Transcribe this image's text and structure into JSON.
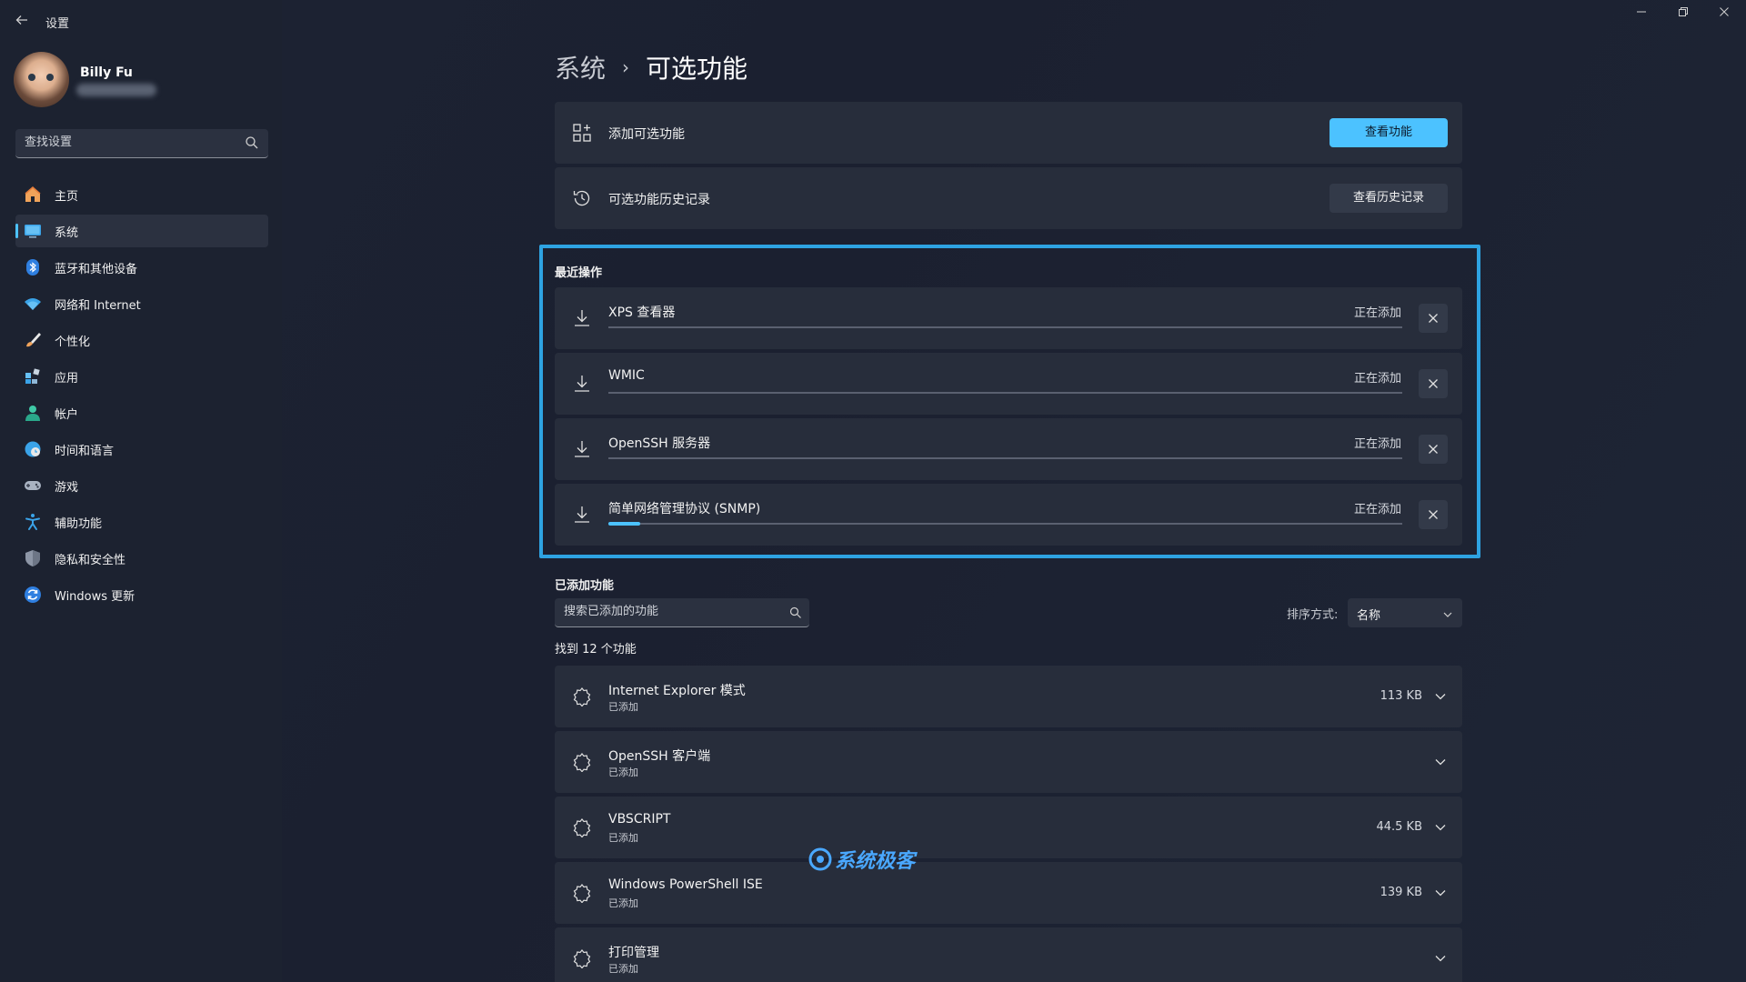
{
  "window": {
    "title": "设置",
    "back": "back-arrow",
    "controls": [
      "minimize",
      "maximize",
      "close"
    ]
  },
  "user": {
    "name": "Billy Fu"
  },
  "search": {
    "placeholder": "查找设置"
  },
  "sidebar": {
    "items": [
      {
        "label": "主页",
        "icon": "home-icon",
        "active": false
      },
      {
        "label": "系统",
        "icon": "system-icon",
        "active": true
      },
      {
        "label": "蓝牙和其他设备",
        "icon": "bluetooth-icon",
        "active": false
      },
      {
        "label": "网络和 Internet",
        "icon": "wifi-icon",
        "active": false
      },
      {
        "label": "个性化",
        "icon": "brush-icon",
        "active": false
      },
      {
        "label": "应用",
        "icon": "apps-icon",
        "active": false
      },
      {
        "label": "帐户",
        "icon": "account-icon",
        "active": false
      },
      {
        "label": "时间和语言",
        "icon": "globe-icon",
        "active": false
      },
      {
        "label": "游戏",
        "icon": "gamepad-icon",
        "active": false
      },
      {
        "label": "辅助功能",
        "icon": "accessibility-icon",
        "active": false
      },
      {
        "label": "隐私和安全性",
        "icon": "shield-icon",
        "active": false
      },
      {
        "label": "Windows 更新",
        "icon": "update-icon",
        "active": false
      }
    ]
  },
  "breadcrumb": {
    "parent": "系统",
    "separator": "›",
    "current": "可选功能"
  },
  "add_feature": {
    "label": "添加可选功能",
    "button": "查看功能"
  },
  "history": {
    "label": "可选功能历史记录",
    "button": "查看历史记录"
  },
  "recent": {
    "title": "最近操作",
    "items": [
      {
        "name": "XPS 查看器",
        "status": "正在添加",
        "progress": 0
      },
      {
        "name": "WMIC",
        "status": "正在添加",
        "progress": 0
      },
      {
        "name": "OpenSSH 服务器",
        "status": "正在添加",
        "progress": 0
      },
      {
        "name": "简单网络管理协议 (SNMP)",
        "status": "正在添加",
        "progress": 0.04
      }
    ]
  },
  "added": {
    "title": "已添加功能",
    "search_placeholder": "搜索已添加的功能",
    "sort_label": "排序方式:",
    "sort_value": "名称",
    "found": "找到 12 个功能",
    "items": [
      {
        "name": "Internet Explorer 模式",
        "status": "已添加",
        "size": "113 KB"
      },
      {
        "name": "OpenSSH 客户端",
        "status": "已添加",
        "size": ""
      },
      {
        "name": "VBSCRIPT",
        "status": "已添加",
        "size": "44.5 KB"
      },
      {
        "name": "Windows PowerShell ISE",
        "status": "已添加",
        "size": "139 KB"
      },
      {
        "name": "打印管理",
        "status": "已添加",
        "size": ""
      }
    ]
  },
  "watermark": {
    "text": "系统极客"
  },
  "colors": {
    "accent": "#4cc2ff",
    "highlight_border": "#2ea3e2",
    "background": "#1c2230",
    "card": "#272d3b"
  }
}
